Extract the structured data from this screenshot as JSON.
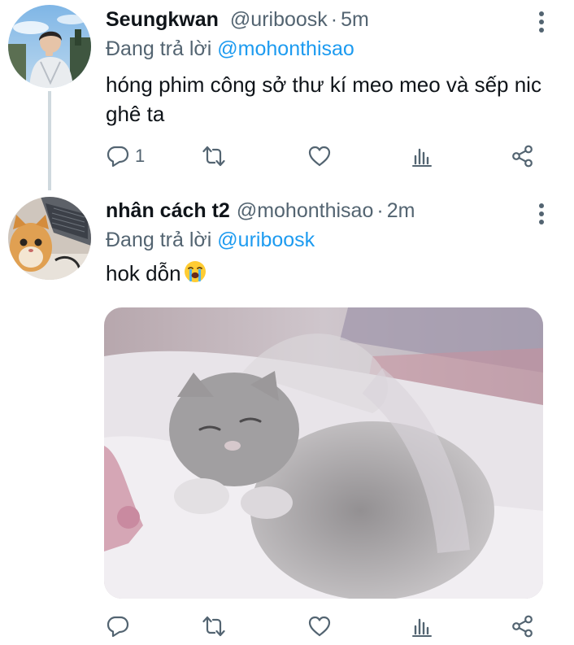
{
  "tweets": [
    {
      "name": "Seungkwan",
      "handle": "@uriboosk",
      "separator": "·",
      "time": "5m",
      "reply_prefix": "Đang trả lời",
      "reply_to": "@mohonthisao",
      "text": "hóng phim công sở thư kí meo meo và sếp nic ghê ta",
      "reply_count": "1",
      "avatar_icon": "avatar-photo-person"
    },
    {
      "name": "nhân cách t2",
      "handle": "@mohonthisao",
      "separator": "·",
      "time": "2m",
      "reply_prefix": "Đang trả lời",
      "reply_to": "@uriboosk",
      "text": "hok dỗn",
      "emoji": "crying-face-emoji",
      "reply_count": "",
      "avatar_icon": "avatar-photo-cat",
      "media": "sleeping-kitten-gif"
    }
  ],
  "colors": {
    "text": "#0f1419",
    "secondary": "#536471",
    "link": "#1d9bf0",
    "thread_line": "#cfd9de"
  }
}
